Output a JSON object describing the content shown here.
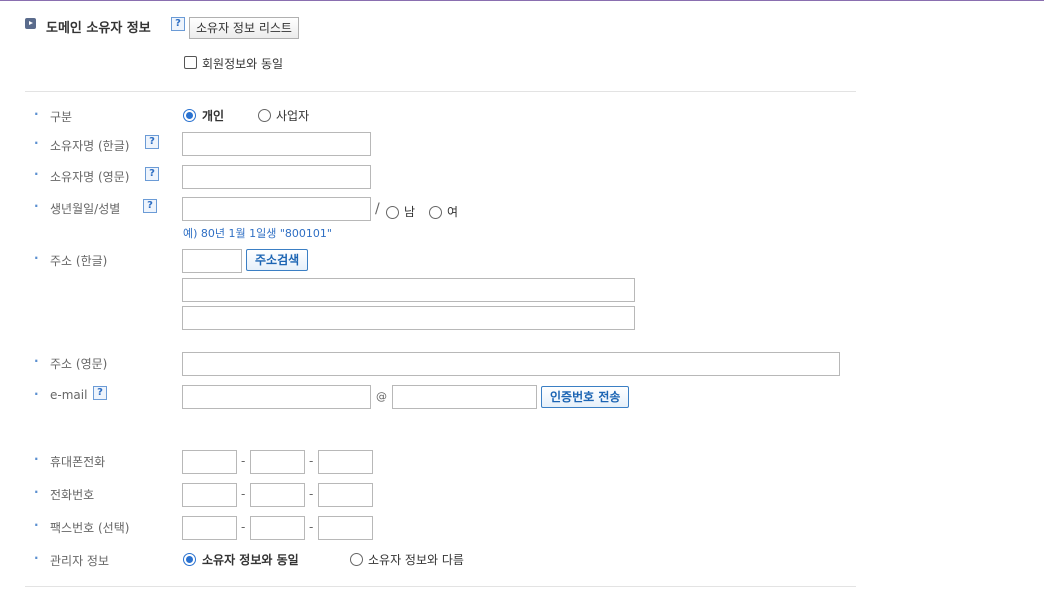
{
  "section": {
    "title": "도메인 소유자 정보",
    "help": "?",
    "list_button": "소유자 정보 리스트",
    "same_as_member": "회원정보와 동일"
  },
  "fields": {
    "type_label": "구분",
    "type_options": [
      "개인",
      "사업자"
    ],
    "type_selected": "개인",
    "name_kr_label": "소유자명 (한글)",
    "name_en_label": "소유자명 (영문)",
    "birth_label": "생년월일/성별",
    "birth_sep": "/",
    "gender_options": [
      "남",
      "여"
    ],
    "birth_hint": "예) 80년 1월 1일생 \"800101\"",
    "addr_kr_label": "주소 (한글)",
    "addr_search_button": "주소검색",
    "addr_en_label": "주소 (영문)",
    "email_label": "e-mail",
    "email_at": "@",
    "email_send_button": "인증번호 전송",
    "mobile_label": "휴대폰전화",
    "phone_label": "전화번호",
    "fax_label": "팩스번호 (선택)",
    "phone_sep": "-",
    "admin_label": "관리자 정보",
    "admin_options": [
      "소유자 정보와 동일",
      "소유자 정보와 다름"
    ],
    "admin_selected": "소유자 정보와 동일"
  },
  "colors": {
    "accent": "#2a72d0",
    "help_border": "#6b9bd6",
    "hint_text": "#2f6fc4"
  }
}
